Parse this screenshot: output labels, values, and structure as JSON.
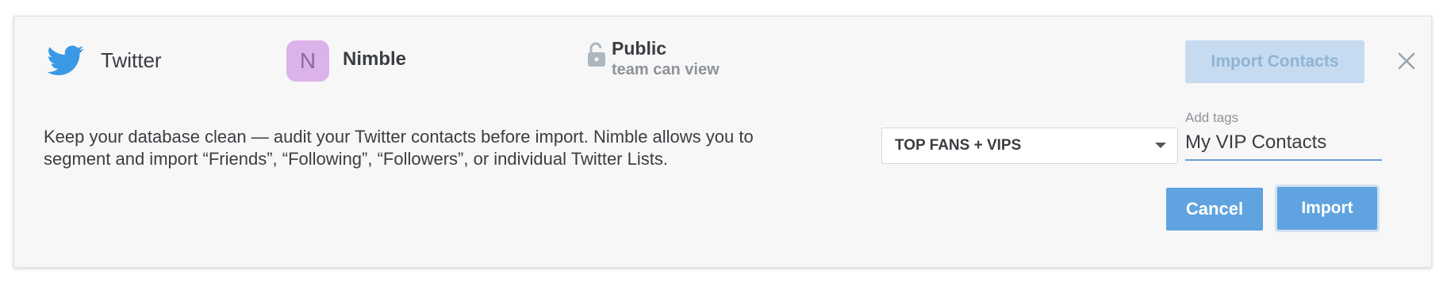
{
  "service": {
    "name": "Twitter",
    "icon": "twitter-bird-icon",
    "icon_color": "#3a99e5"
  },
  "account": {
    "avatar_letter": "N",
    "name": "Nimble",
    "avatar_color": "#dcb2ea"
  },
  "visibility": {
    "icon": "unlocked-padlock-icon",
    "title": "Public",
    "subtitle": "team can view"
  },
  "header": {
    "import_contacts_label": "Import Contacts",
    "close_icon": "close-icon"
  },
  "description": "Keep your database clean — audit your Twitter contacts before import.  Nimble allows you to segment and import “Friends”, “Following”, “Followers”, or  individual Twitter Lists.",
  "segment_select": {
    "selected": "TOP FANS + VIPS",
    "icon": "caret-down-icon"
  },
  "tags": {
    "label": "Add tags",
    "value": "My VIP Contacts"
  },
  "actions": {
    "cancel_label": "Cancel",
    "import_label": "Import"
  },
  "colors": {
    "primary": "#5fa3e0",
    "disabled": "#c6dbef",
    "panel_bg": "#f7f7f7"
  }
}
